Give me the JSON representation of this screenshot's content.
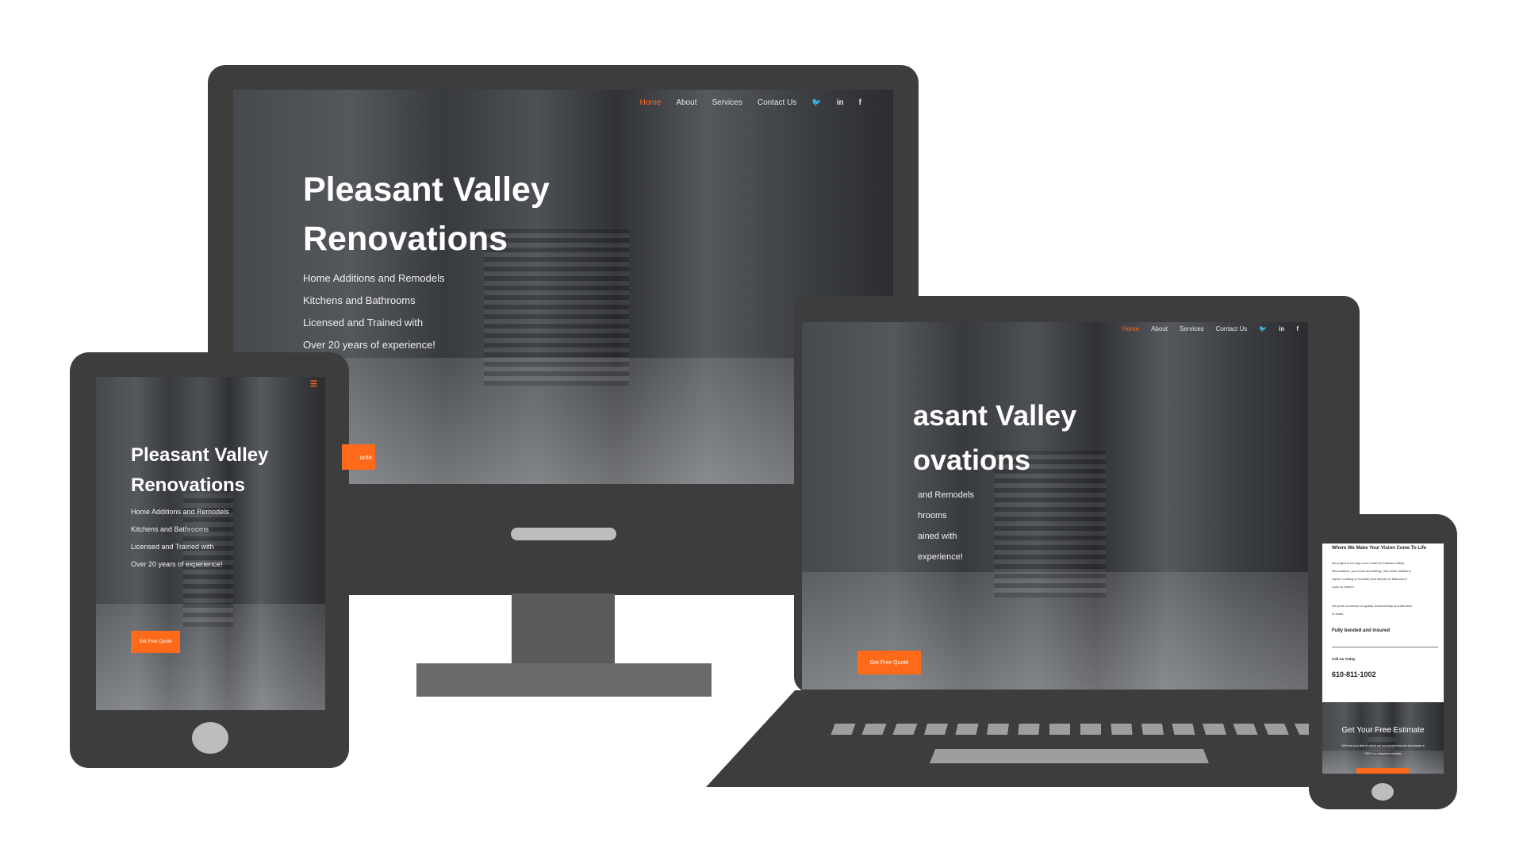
{
  "brand_accent": "#ff6a1a",
  "site": {
    "title_line1": "Pleasant Valley",
    "title_line2": "Renovations",
    "tagline": [
      "Home Additions and Remodels",
      "Kitchens and Bathrooms",
      "Licensed and Trained with",
      "Over 20 years of experience!"
    ],
    "cta": "Get Free Quote",
    "nav": {
      "home": "Home",
      "about": "About",
      "services": "Services",
      "contact": "Contact Us"
    },
    "social_icons": [
      "twitter-icon",
      "linkedin-icon",
      "facebook-icon"
    ],
    "menu_icon": "hamburger-menu-icon"
  },
  "laptop_cropped": {
    "title_line1": "asant Valley",
    "title_line2": "ovations",
    "tagline": [
      "and Remodels",
      "hrooms",
      "ained with",
      "experience!"
    ]
  },
  "desktop_cta_cropped": "uote",
  "phone": {
    "heading": "Where We Make Your Vision Come To Life",
    "para1_lines": [
      "No project is too big or too small for Pleasant Valley",
      "Renovations, your local remodeling, and home additions",
      "expert. Looking to remodel your kitchen or bathroom?",
      "Look no further!"
    ],
    "para2_lines": [
      "We pride ourselves on quality workmanship and attention",
      "to detail."
    ],
    "bonded": "Fully bonded and insured",
    "call_label": "Call Us Today",
    "phone_number": "610-811-1002",
    "estimate_title": "Get Your Free Estimate",
    "estimate_lines": [
      "We'll set up a time to check out your project and we will prepare a",
      "FREE no-obligation estimate"
    ]
  }
}
